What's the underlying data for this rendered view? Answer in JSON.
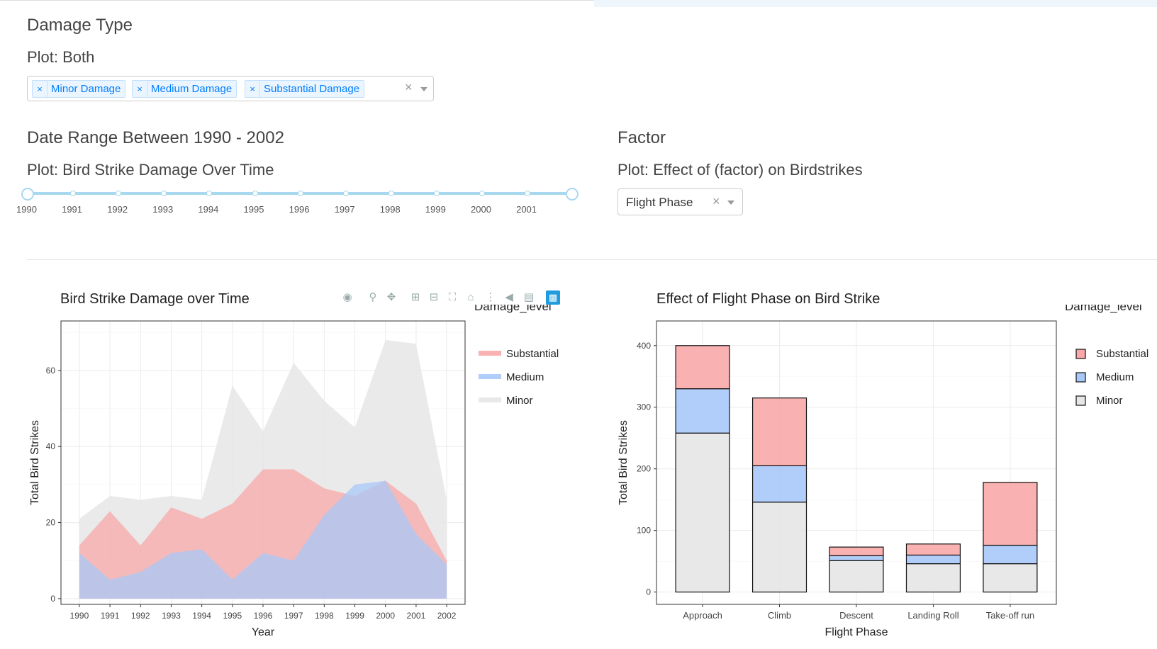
{
  "section_damage": {
    "heading": "Damage Type",
    "subheading": "Plot: Both",
    "chips": [
      {
        "remove": "×",
        "label": "Minor Damage"
      },
      {
        "remove": "×",
        "label": "Medium Damage"
      },
      {
        "remove": "×",
        "label": "Substantial Damage"
      }
    ],
    "clear": "×"
  },
  "section_date": {
    "heading": "Date Range Between 1990 - 2002",
    "subheading": "Plot: Bird Strike Damage Over Time",
    "slider_labels": [
      "1990",
      "1991",
      "1992",
      "1993",
      "1994",
      "1995",
      "1996",
      "1997",
      "1998",
      "1999",
      "2000",
      "2001"
    ]
  },
  "section_factor": {
    "heading": "Factor",
    "subheading": "Plot: Effect of (factor) on Birdstrikes",
    "selected": "Flight Phase",
    "clear": "×"
  },
  "colors": {
    "substantial": "#f8a8a8",
    "medium": "#a8c8f8",
    "minor": "#e6e6e6",
    "accent": "#1f9bde"
  },
  "modebar_icons": [
    "camera-icon",
    "zoom-icon",
    "pan-icon",
    "zoom-in-icon",
    "zoom-out-icon",
    "autoscale-icon",
    "reset-axes-icon",
    "spike-lines-icon",
    "hover-closest-icon",
    "hover-compare-icon",
    "plotly-logo-icon"
  ],
  "chart_data": [
    {
      "type": "area",
      "title": "Bird Strike Damage over Time",
      "xlabel": "Year",
      "ylabel": "Total Bird Strikes",
      "legend_title": "Damage_level",
      "legend": [
        "Substantial",
        "Medium",
        "Minor"
      ],
      "x": [
        1990,
        1991,
        1992,
        1993,
        1994,
        1995,
        1996,
        1997,
        1998,
        1999,
        2000,
        2001,
        2002
      ],
      "ylim": [
        0,
        70
      ],
      "yticks": [
        0,
        20,
        40,
        60
      ],
      "series": [
        {
          "name": "Minor",
          "values": [
            21,
            27,
            26,
            27,
            26,
            56,
            44,
            62,
            52,
            45,
            68,
            67,
            26
          ]
        },
        {
          "name": "Substantial",
          "values": [
            14,
            23,
            14,
            24,
            21,
            25,
            34,
            34,
            29,
            27,
            31,
            25,
            10
          ]
        },
        {
          "name": "Medium",
          "values": [
            12,
            5,
            7,
            12,
            13,
            5,
            12,
            10,
            22,
            30,
            31,
            17,
            9
          ]
        }
      ],
      "grid": true
    },
    {
      "type": "bar",
      "stacked": true,
      "title": "Effect of Flight Phase on Bird Strike",
      "xlabel": "Flight Phase",
      "ylabel": "Total Bird Strikes",
      "legend_title": "Damage_level",
      "legend": [
        "Substantial",
        "Medium",
        "Minor"
      ],
      "categories": [
        "Approach",
        "Climb",
        "Descent",
        "Landing Roll",
        "Take-off run"
      ],
      "ylim": [
        0,
        440
      ],
      "yticks": [
        0,
        100,
        200,
        300,
        400
      ],
      "series": [
        {
          "name": "Minor",
          "values": [
            258,
            146,
            51,
            46,
            46
          ]
        },
        {
          "name": "Medium",
          "values": [
            72,
            59,
            8,
            14,
            30
          ]
        },
        {
          "name": "Substantial",
          "values": [
            70,
            110,
            14,
            18,
            102
          ]
        }
      ],
      "grid": true
    }
  ]
}
